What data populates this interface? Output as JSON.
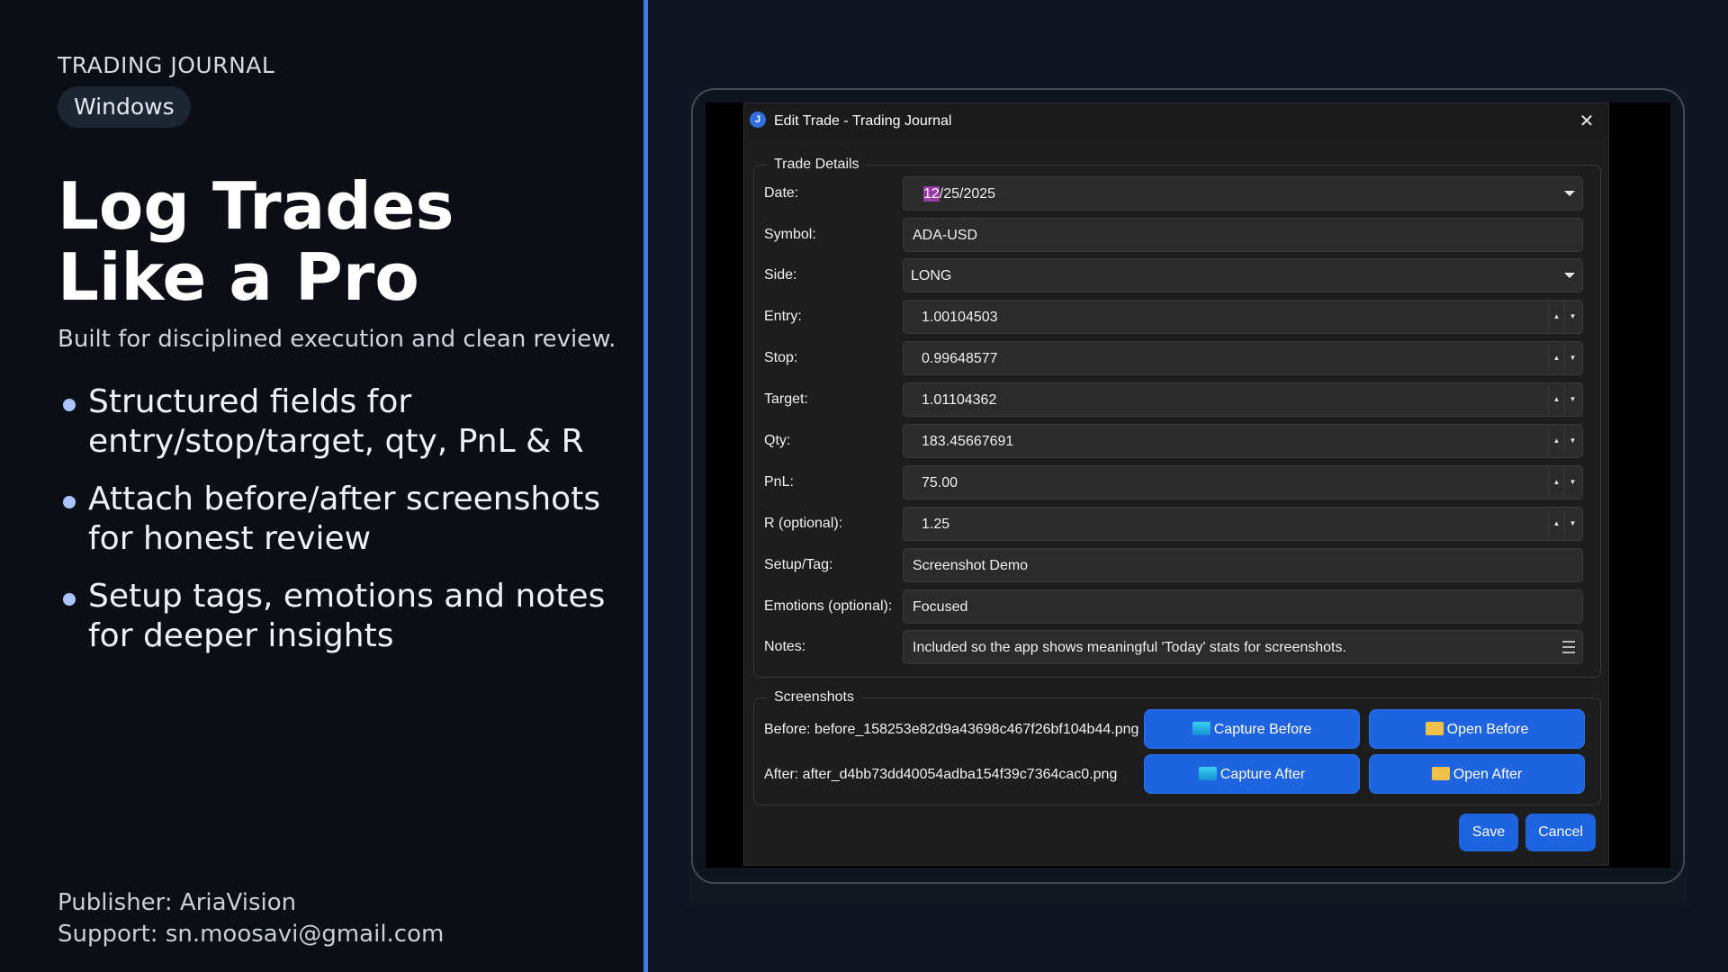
{
  "promo": {
    "brand": "TRADING JOURNAL",
    "platform": "Windows",
    "headline_line1": "Log Trades",
    "headline_line2": "Like a Pro",
    "subhead": "Built for disciplined execution and clean review.",
    "bullets": [
      {
        "line1": "Structured fields for",
        "line2": "entry/stop/target, qty, PnL & R"
      },
      {
        "line1": "Attach before/after screenshots",
        "line2": "for honest review"
      },
      {
        "line1": "Setup tags, emotions and notes",
        "line2": "for deeper insights"
      }
    ],
    "publisher": "Publisher: AriaVision",
    "support": "Support: sn.moosavi@gmail.com"
  },
  "dialog": {
    "title": "Edit Trade - Trading Journal",
    "icon_letter": "J",
    "trade_details": {
      "group_label": "Trade Details",
      "date": {
        "label": "Date:",
        "highlighted": "12",
        "rest": "/25/2025"
      },
      "symbol": {
        "label": "Symbol:",
        "value": "ADA-USD"
      },
      "side": {
        "label": "Side:",
        "value": "LONG"
      },
      "entry": {
        "label": "Entry:",
        "value": "1.00104503"
      },
      "stop": {
        "label": "Stop:",
        "value": "0.99648577"
      },
      "target": {
        "label": "Target:",
        "value": "1.01104362"
      },
      "qty": {
        "label": "Qty:",
        "value": "183.45667691"
      },
      "pnl": {
        "label": "PnL:",
        "value": "75.00"
      },
      "r": {
        "label": "R (optional):",
        "value": "1.25"
      },
      "setup": {
        "label": "Setup/Tag:",
        "value": "Screenshot Demo"
      },
      "emotions": {
        "label": "Emotions (optional):",
        "value": "Focused"
      },
      "notes": {
        "label": "Notes:",
        "value": "Included so the app shows meaningful 'Today' stats for screenshots."
      }
    },
    "screenshots": {
      "group_label": "Screenshots",
      "before_label": "Before: before_158253e82d9a43698c467f26bf104b44.png",
      "after_label": "After: after_d4bb73dd40054adba154f39c7364cac0.png",
      "capture_before": "Capture Before",
      "open_before": "Open Before",
      "capture_after": "Capture After",
      "open_after": "Open After"
    },
    "save_label": "Save",
    "cancel_label": "Cancel"
  },
  "icons": {
    "close": "close-icon",
    "capture": "monitor-icon",
    "open": "folder-icon",
    "dropdown": "chevron-down-icon",
    "spin_up": "spin-up-icon",
    "spin_down": "spin-down-icon"
  },
  "colors": {
    "accent": "#3b7be6",
    "button": "#1e63e0",
    "background": "#0b0e14",
    "date_highlight": "#9b3ba8"
  }
}
